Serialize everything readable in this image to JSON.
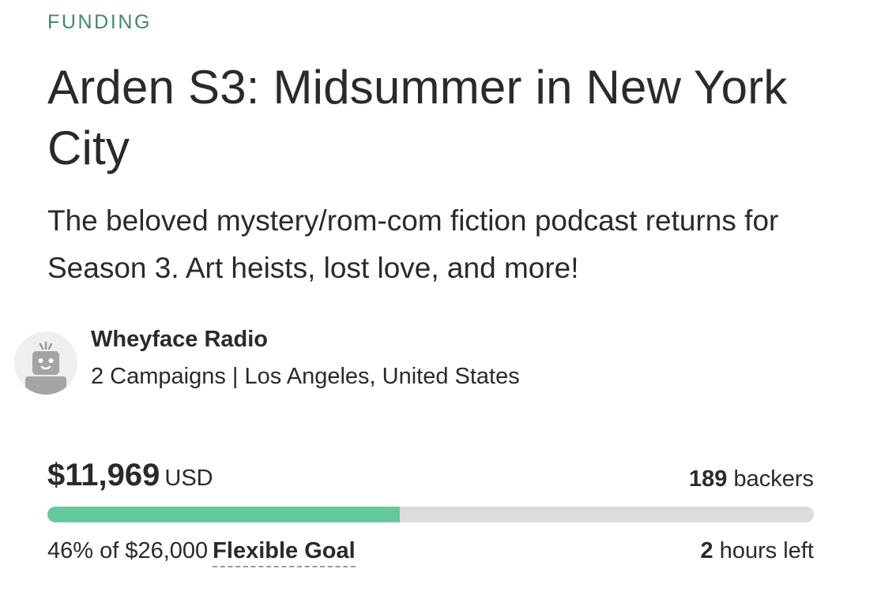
{
  "section": {
    "label": "FUNDING"
  },
  "campaign": {
    "title": "Arden S3: Midsummer in New York City",
    "blurb": "The beloved mystery/rom-com fiction podcast returns for Season 3. Art heists, lost love, and more!"
  },
  "creator": {
    "name": "Wheyface Radio",
    "meta": "2 Campaigns | Los Angeles, United States",
    "avatar_icon": "robot-avatar-icon"
  },
  "funding": {
    "amount": "$11,969",
    "currency": "USD",
    "backers_count": "189",
    "backers_label": "backers",
    "progress_percent": 46,
    "goal_summary": "46% of $26,000",
    "goal_type": "Flexible Goal",
    "time_value": "2",
    "time_label": "hours left"
  },
  "colors": {
    "accent_label": "#3f8a6f",
    "progress_fill": "#65c99e",
    "progress_track": "#dcdcdc"
  }
}
